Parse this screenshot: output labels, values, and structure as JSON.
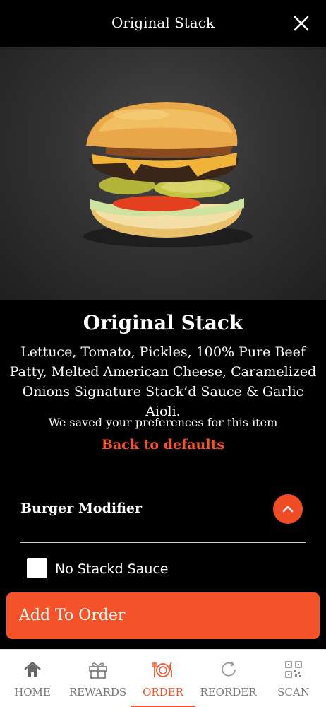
{
  "header": {
    "title": "Original Stack",
    "close_icon": "close-icon"
  },
  "item": {
    "name": "Original Stack",
    "description": "Lettuce, Tomato, Pickles, 100% Pure Beef Patty, Melted American Cheese, Caramelized Onions Signature Stack’d Sauce & Garlic Aioli."
  },
  "preferences": {
    "saved_text": "We saved your preferences for this item",
    "back_label": "Back to defaults"
  },
  "modifier": {
    "title": "Burger Modifier",
    "toggle_icon": "chevron-up-icon",
    "options": [
      {
        "label": "No Stackd Sauce",
        "checked": false
      }
    ]
  },
  "add_button": {
    "label": "Add To Order"
  },
  "tabbar": {
    "tabs": [
      {
        "label": "HOME",
        "icon": "home-icon"
      },
      {
        "label": "REWARDS",
        "icon": "gift-icon"
      },
      {
        "label": "ORDER",
        "icon": "plate-icon",
        "active": true
      },
      {
        "label": "REORDER",
        "icon": "refresh-icon"
      },
      {
        "label": "SCAN",
        "icon": "qr-code-icon"
      }
    ]
  },
  "colors": {
    "accent": "#f4532a",
    "background": "#000000",
    "tabbar": "#ffffff"
  }
}
